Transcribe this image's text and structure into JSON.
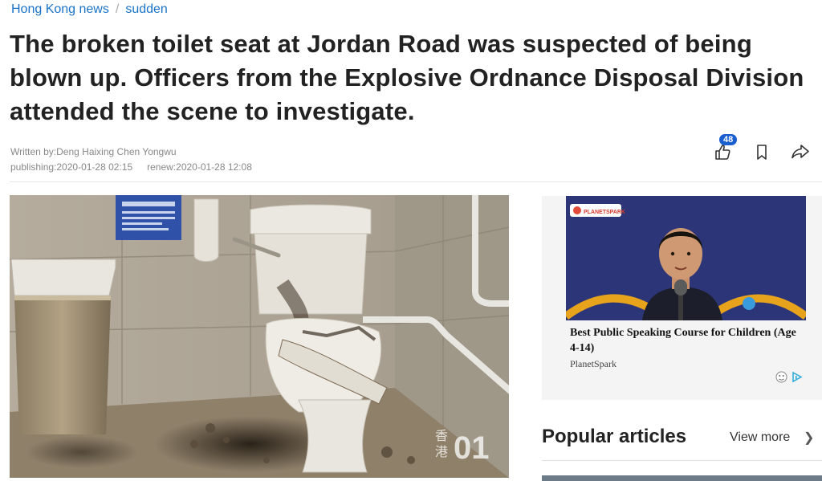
{
  "breadcrumb": {
    "section": "Hong Kong news",
    "subsection": "sudden",
    "separator": "/"
  },
  "article": {
    "title": "The broken toilet seat at Jordan Road was suspected of being blown up. Officers from the Explosive Ordnance Disposal Division attended the scene to investigate.",
    "authors": "Written by:Deng Haixing Chen Yongwu",
    "published": "publishing:2020-01-28 02:15",
    "renewed": "renew:2020-01-28 12:08",
    "like_count": "48"
  },
  "photo": {
    "watermark_cn_1": "香",
    "watermark_cn_2": "港",
    "watermark_logo": "01"
  },
  "ad": {
    "brand_logo": "PLANETSPARK",
    "title": "Best Public Speaking Course for Children (Age 4-14)",
    "brand": "PlanetSpark"
  },
  "popular": {
    "title": "Popular articles",
    "view_more": "View more"
  },
  "colors": {
    "link": "#1a73c8",
    "badge": "#1a5fd0",
    "ad_bg": "#2c3577"
  }
}
